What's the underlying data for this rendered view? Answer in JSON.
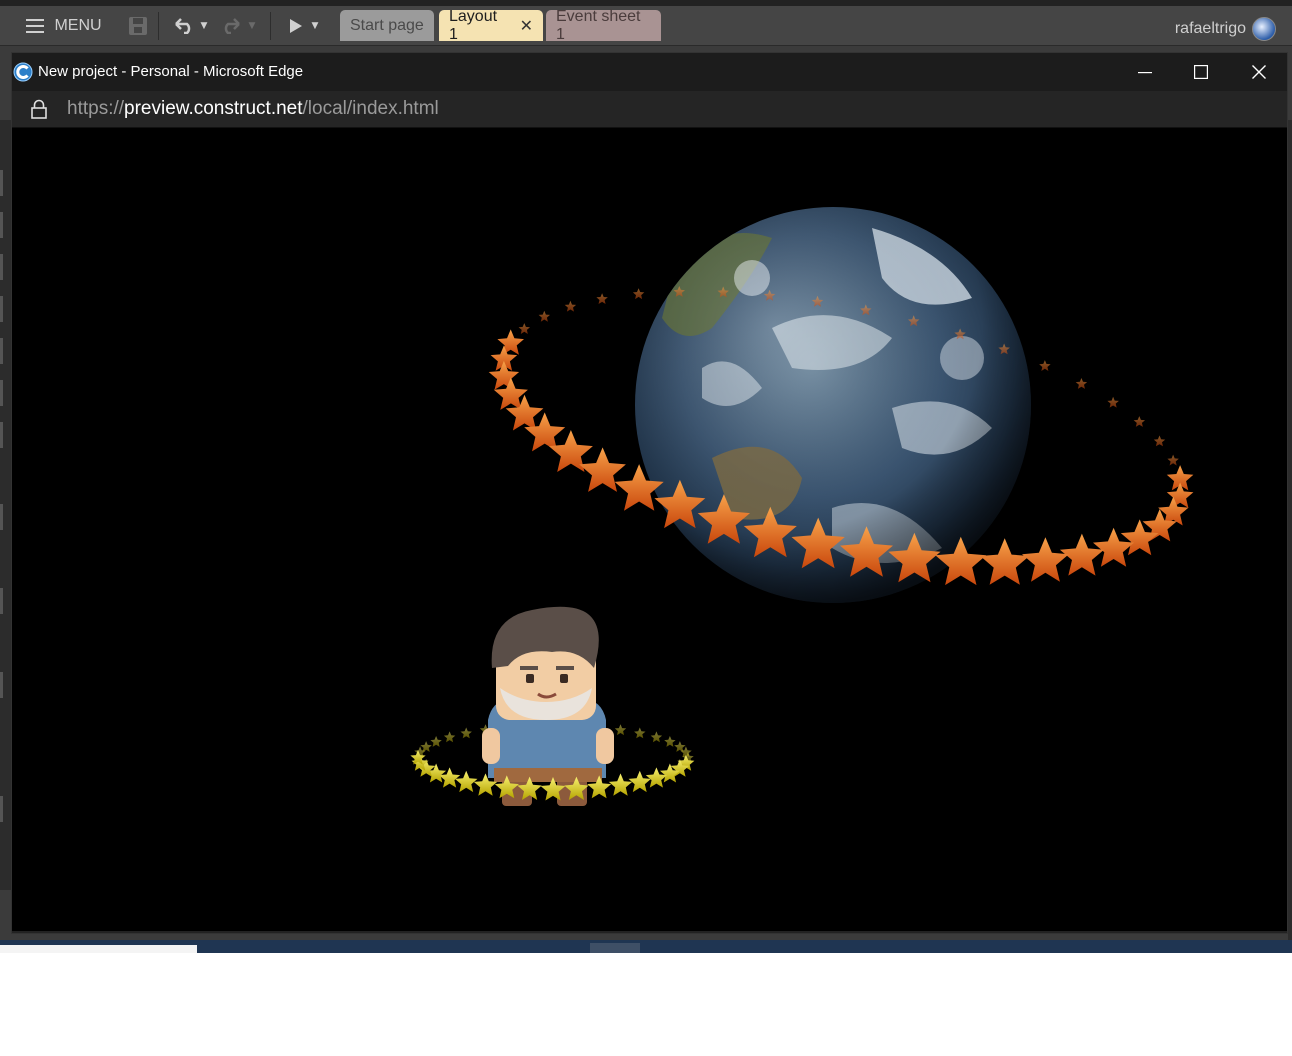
{
  "editor": {
    "menu_label": "MENU",
    "tabs": [
      {
        "label": "Start page"
      },
      {
        "label": "Layout 1",
        "close": "✕"
      },
      {
        "label": "Event sheet 1"
      }
    ],
    "username": "rafaeltrigo"
  },
  "browser": {
    "title": "New project - Personal - Microsoft Edge",
    "url": {
      "scheme": "https://",
      "host": "preview.construct.net",
      "path": "/local/index.html"
    }
  },
  "colors": {
    "active_tab": "#f5e3b2",
    "star_orange": "#e8701a",
    "star_yellow": "#e7d60a",
    "background": "#000000"
  },
  "scene": {
    "objects": [
      "earth-sprite",
      "orange-star-ring",
      "character-sprite",
      "yellow-star-ring"
    ]
  }
}
